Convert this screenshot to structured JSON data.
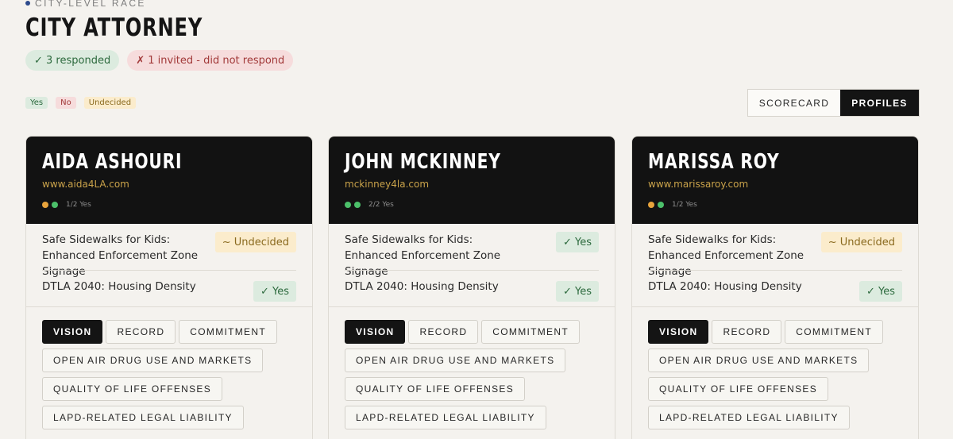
{
  "race": {
    "eyebrow": "CITY-LEVEL RACE",
    "title": "CITY ATTORNEY",
    "responded": "✓ 3 responded",
    "not_responded": "✗ 1 invited - did not respond"
  },
  "legend": {
    "yes": "Yes",
    "no": "No",
    "undecided": "Undecided"
  },
  "view_toggle": {
    "scorecard": "SCORECARD",
    "profiles": "PROFILES",
    "active": "profiles"
  },
  "colors": {
    "yes": "#4cc06a",
    "undecided": "#e8a43c",
    "accent": "#c9a24a",
    "dark": "#121212"
  },
  "candidates": [
    {
      "name": "AIDA ASHOURI",
      "url": "www.aida4LA.com",
      "score_label": "1/2 Yes",
      "score_dots": [
        "undecided",
        "yes"
      ],
      "questions": [
        {
          "text": "Safe Sidewalks for Kids: Enhanced Enforcement Zone Signage",
          "answer": "~ Undecided",
          "kind": "und"
        },
        {
          "text": "DTLA 2040: Housing Density",
          "answer": "✓ Yes",
          "kind": "yes"
        }
      ],
      "tabs": [
        "VISION",
        "RECORD",
        "COMMITMENT",
        "OPEN AIR DRUG USE AND MARKETS",
        "QUALITY OF LIFE OFFENSES",
        "LAPD-RELATED LEGAL LIABILITY"
      ]
    },
    {
      "name": "JOHN MCKINNEY",
      "url": "mckinney4la.com",
      "score_label": "2/2 Yes",
      "score_dots": [
        "yes",
        "yes"
      ],
      "questions": [
        {
          "text": "Safe Sidewalks for Kids: Enhanced Enforcement Zone Signage",
          "answer": "✓ Yes",
          "kind": "yes"
        },
        {
          "text": "DTLA 2040: Housing Density",
          "answer": "✓ Yes",
          "kind": "yes"
        }
      ],
      "tabs": [
        "VISION",
        "RECORD",
        "COMMITMENT",
        "OPEN AIR DRUG USE AND MARKETS",
        "QUALITY OF LIFE OFFENSES",
        "LAPD-RELATED LEGAL LIABILITY"
      ]
    },
    {
      "name": "MARISSA ROY",
      "url": "www.marissaroy.com",
      "score_label": "1/2 Yes",
      "score_dots": [
        "undecided",
        "yes"
      ],
      "questions": [
        {
          "text": "Safe Sidewalks for Kids: Enhanced Enforcement Zone Signage",
          "answer": "~ Undecided",
          "kind": "und"
        },
        {
          "text": "DTLA 2040: Housing Density",
          "answer": "✓ Yes",
          "kind": "yes"
        }
      ],
      "tabs": [
        "VISION",
        "RECORD",
        "COMMITMENT",
        "OPEN AIR DRUG USE AND MARKETS",
        "QUALITY OF LIFE OFFENSES",
        "LAPD-RELATED LEGAL LIABILITY"
      ]
    }
  ]
}
